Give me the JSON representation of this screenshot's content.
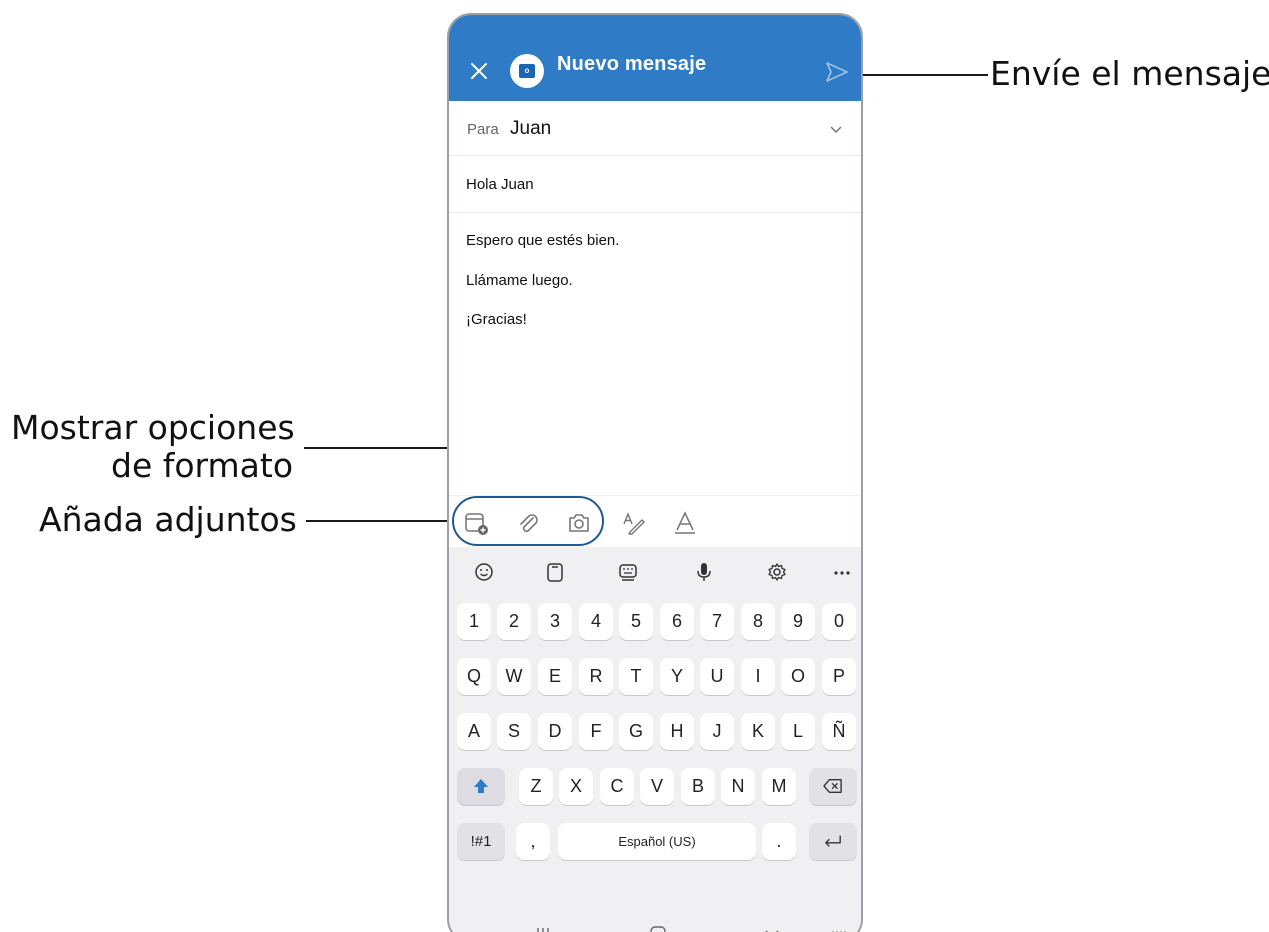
{
  "callouts": {
    "send": "Envíe el mensaje",
    "format_line1": "Mostrar opciones",
    "format_line2": "de formato",
    "attachments": "Añada adjuntos"
  },
  "appbar": {
    "title": "Nuevo mensaje",
    "color": "#2f7bc6"
  },
  "compose": {
    "to_label": "Para",
    "to_value": "Juan",
    "subject": "Hola Juan",
    "body": [
      "Espero que estés bien.",
      "Llámame luego.",
      "¡Gracias!"
    ]
  },
  "toolbar": {
    "icons": [
      "calendar-add-icon",
      "paperclip-icon",
      "camera-icon",
      "pen-format-icon",
      "text-format-icon"
    ]
  },
  "keyboard": {
    "top_icons": [
      "emoji-icon",
      "clipboard-icon",
      "keyboard-icon",
      "microphone-icon",
      "settings-icon",
      "more-icon"
    ],
    "row_numbers": [
      "1",
      "2",
      "3",
      "4",
      "5",
      "6",
      "7",
      "8",
      "9",
      "0"
    ],
    "row_q": [
      "Q",
      "W",
      "E",
      "R",
      "T",
      "Y",
      "U",
      "I",
      "O",
      "P"
    ],
    "row_a": [
      "A",
      "S",
      "D",
      "F",
      "G",
      "H",
      "J",
      "K",
      "L",
      "Ñ"
    ],
    "row_z": [
      "Z",
      "X",
      "C",
      "V",
      "B",
      "N",
      "M"
    ],
    "sym_key": "!#1",
    "comma_key": ",",
    "space_label": "Español (US)",
    "period_key": "."
  },
  "navbar": {
    "icons": [
      "recents-icon",
      "home-icon",
      "back-icon",
      "keyboard-switch-icon"
    ]
  }
}
